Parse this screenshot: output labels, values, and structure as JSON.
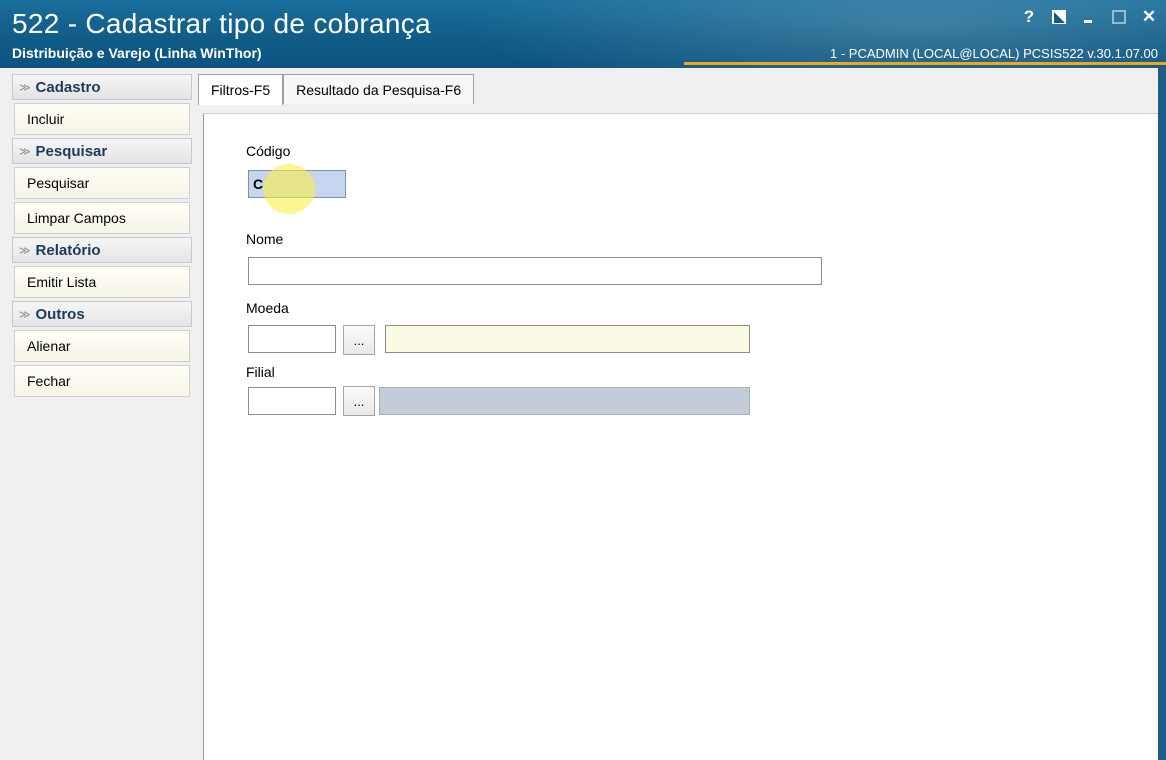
{
  "window": {
    "title": "522 - Cadastrar tipo de cobrança",
    "subtitle": "Distribuição e Varejo (Linha WinThor)",
    "user_info": "1 - PCADMIN (LOCAL@LOCAL)   PCSIS522  v.30.1.07.00",
    "controls": {
      "help": "?",
      "close": "✕"
    }
  },
  "sidebar": {
    "groups": [
      {
        "label": "Cadastro",
        "items": [
          "Incluir"
        ]
      },
      {
        "label": "Pesquisar",
        "items": [
          "Pesquisar",
          "Limpar Campos"
        ]
      },
      {
        "label": "Relatório",
        "items": [
          "Emitir Lista"
        ]
      },
      {
        "label": "Outros",
        "items": [
          "Alienar",
          "Fechar"
        ]
      }
    ]
  },
  "tabs": [
    {
      "label": "Filtros-F5",
      "active": true
    },
    {
      "label": "Resultado da Pesquisa-F6",
      "active": false
    }
  ],
  "form": {
    "codigo": {
      "label": "Código",
      "value": "C"
    },
    "nome": {
      "label": "Nome",
      "value": ""
    },
    "moeda": {
      "label": "Moeda",
      "value": "",
      "browse": "...",
      "description": ""
    },
    "filial": {
      "label": "Filial",
      "value": "",
      "browse": "...",
      "description": ""
    }
  },
  "colors": {
    "titlebar": "#0f5b86",
    "accent": "#f3a51f"
  }
}
